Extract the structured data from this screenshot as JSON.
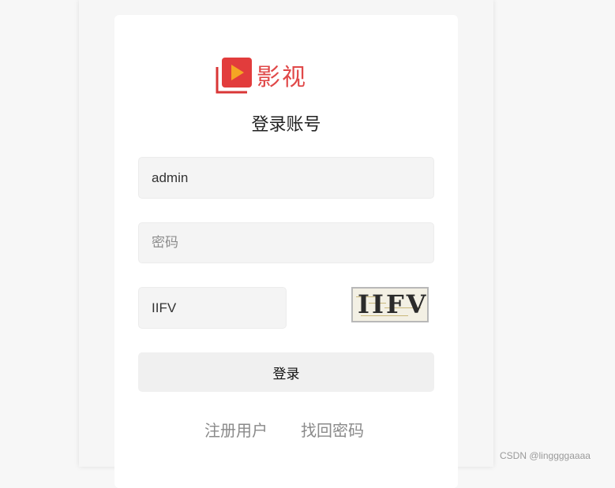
{
  "logo": {
    "text": "影视",
    "icon": "play-icon",
    "brand_color": "#e04848",
    "accent_color": "#f5a623"
  },
  "form": {
    "title": "登录账号",
    "username_value": "admin",
    "password_placeholder": "密码",
    "captcha_value": "IIFV",
    "captcha_image_text": "IIFV",
    "submit_label": "登录"
  },
  "links": {
    "register": "注册用户",
    "forgot_password": "找回密码"
  },
  "watermark": "CSDN @linggggaaaa"
}
